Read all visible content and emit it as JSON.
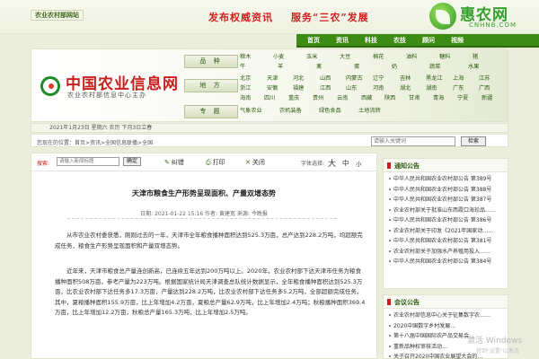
{
  "topbar": {
    "site_tag": "农业农村部网站",
    "slogan_left": "发布权威资讯",
    "slogan_right": "服务“三农”发展",
    "brand_name": "惠农网",
    "brand_url": "CNHNB.COM"
  },
  "nav": [
    "首页",
    "资讯",
    "科技",
    "农技",
    "顾问",
    "视频"
  ],
  "header": {
    "site_name": "中国农业信息网",
    "site_subtitle": "农业农村部信息中心主办",
    "categories": [
      {
        "label": "品 种",
        "items": [
          "粮木",
          "小麦",
          "玉米",
          "大豆",
          "棉花",
          "油料",
          "糖料",
          "猪",
          "牛",
          "羊",
          "禽",
          "蛋",
          "奶",
          "蔬菜",
          "水果"
        ]
      },
      {
        "label": "地 方",
        "items": [
          "北京",
          "天津",
          "河北",
          "山西",
          "内蒙古",
          "辽宁",
          "吉林",
          "黑龙江",
          "上海",
          "江苏",
          "浙江",
          "安徽",
          "福建",
          "江西",
          "山东",
          "河南",
          "湖北",
          "湖南",
          "广东",
          "广西",
          "海南",
          "四川",
          "重庆",
          "贵州",
          "云南",
          "西藏",
          "陕西",
          "甘肃",
          "青海",
          "宁夏",
          "新疆"
        ]
      },
      {
        "label": "专 题",
        "items": [
          "气象农业",
          "农机装备",
          "绿色食品",
          "土地流转"
        ]
      }
    ]
  },
  "datebar": "2021年1月23日 星期六 农历 下月3日立春",
  "breadcrumb": "您现在的位置：首页>资讯>全国信息联播>全国",
  "search": {
    "placeholder": "请输入关键词",
    "button": "检索"
  },
  "article_tools": {
    "search_label": "搜索:",
    "search_placeholder": "请输入新闻标题",
    "search_button": "确定",
    "error_label": "纠错",
    "print_label": "打印",
    "close_label": "关闭",
    "size_label": "字体选择:",
    "size_large": "大",
    "size_mid": "中",
    "size_small": "小"
  },
  "article": {
    "title": "天津市粮食生产形势呈现面积、产量双增态势",
    "meta": "日期: 2021-01-22 15:16 作者: 黄建宽 来源: 今晚报",
    "paragraphs": [
      "从市农业农村委获悉，刚刚过去的一年，天津市全年粮食播种面积达到525.3万亩，总产达到228.2万吨，均超额完成任务，粮食生产形势呈现面积和产量双增态势。",
      "近年来，天津市粮食总产量连创新高，已连续五年达到200万吨以上。2020年，农业农村部下达天津市任务为粮食播种面积508万亩，参考产量为223万吨。根据国家统计局天津调查总队统计数据显示，全年粮食播种面积达到525.3万亩，比农业农村部下达任务多17.3万亩，产量达到228.2万吨，比农业农村部下达任务多5.2万吨，全部超额完成任务。其中，夏粮播种面积155.9万亩，比上年增加4.2万亩，夏粮总产量62.9万吨，比上年增加2.4万吨；秋粮播种面积369.4万亩，比上年增加12.2万亩，秋粮总产量165.3万吨，比上年增加2.5万吨。"
    ]
  },
  "sidebar": {
    "notice_title": "通知公告",
    "notices": [
      "中华人民共和国农业农村部公告 第389号",
      "中华人民共和国农业农村部公告 第388号",
      "中华人民共和国农业农村部公告 第387号",
      "农业农村部关于批准山东西霞口海珍品……",
      "中华人民共和国农业农村部公告 第386号",
      "农业农村部关于印发《2021年国家动……",
      "中华人民共和国农业农村部公告 第381号",
      "农业农村部关于加强水产养殖用投入……",
      "中华人民共和国农业农村部公告 第384号"
    ],
    "meeting_title": "会议公告",
    "meetings": [
      "农业农村部信息中心关于征集数字农……",
      "2020中国数字乡村发展…",
      "第十八届中国国际农产品交易会…",
      "重新品种权审核活动…",
      "关于召开2020中国农业展望大会的…"
    ]
  },
  "watermark": {
    "line1": "激活 Windows",
    "line2": "转到\"设置\"以激活"
  },
  "colors": {
    "accent_green": "#3d8a14",
    "accent_red": "#c81e1e",
    "brand_green": "#36a02c"
  }
}
